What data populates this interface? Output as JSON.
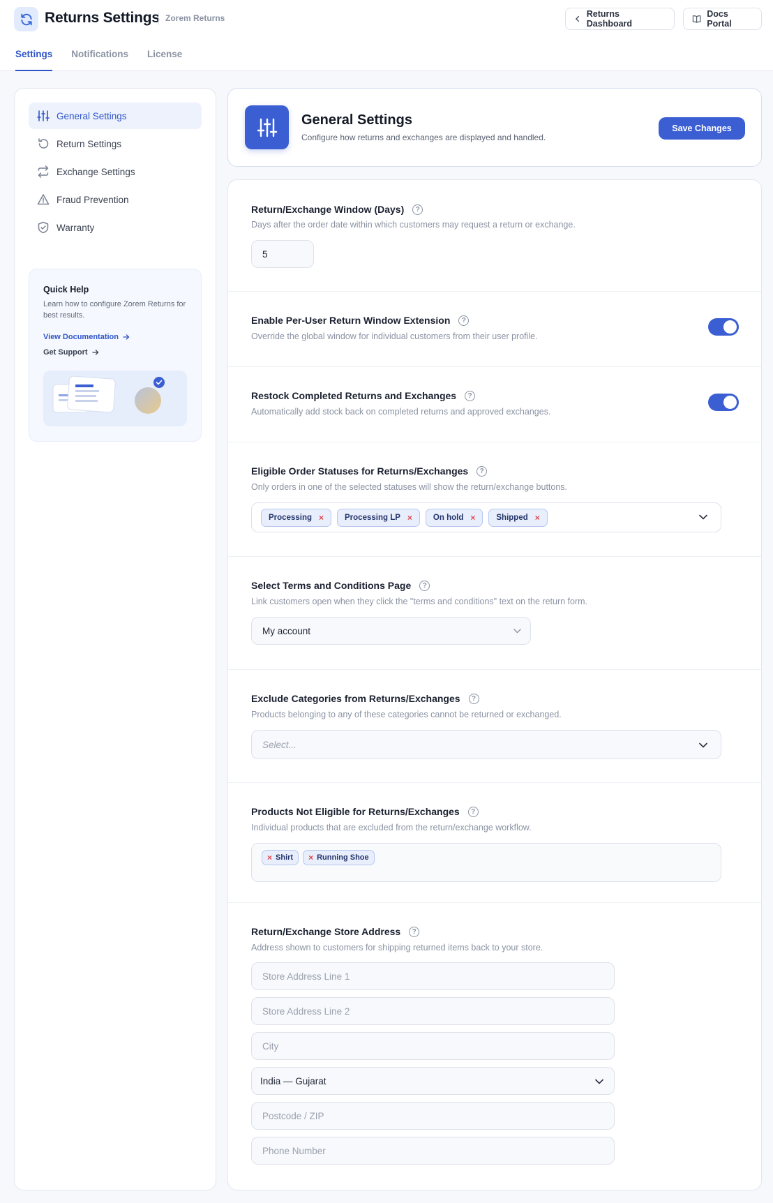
{
  "header": {
    "title": "Returns Settings",
    "subtitle": "Zorem Returns",
    "buttons": {
      "dashboard": "Returns Dashboard",
      "docs": "Docs Portal"
    },
    "tabs": [
      "Settings",
      "Notifications",
      "License"
    ]
  },
  "sidebar": {
    "items": [
      {
        "label": "General Settings",
        "icon": "sliders-icon"
      },
      {
        "label": "Return Settings",
        "icon": "return-icon"
      },
      {
        "label": "Exchange Settings",
        "icon": "exchange-icon"
      },
      {
        "label": "Fraud Prevention",
        "icon": "warning-icon"
      },
      {
        "label": "Warranty",
        "icon": "shield-icon"
      }
    ],
    "help": {
      "title": "Quick Help",
      "text": "Learn how to configure Zorem Returns for best results.",
      "docs_link": "View Documentation",
      "support_link": "Get Support"
    }
  },
  "main": {
    "title": "General Settings",
    "description": "Configure how returns and exchanges are displayed and handled.",
    "save_label": "Save Changes"
  },
  "settings": {
    "window": {
      "title": "Return/Exchange Window (Days)",
      "desc": "Days after the order date within which customers may request a return or exchange.",
      "value": "5"
    },
    "extension": {
      "title": "Enable Per-User Return Window Extension",
      "desc": "Override the global window for individual customers from their user profile.",
      "enabled": true
    },
    "restock": {
      "title": "Restock Completed Returns and Exchanges",
      "desc": "Automatically add stock back on completed returns and approved exchanges.",
      "enabled": true
    },
    "statuses": {
      "title": "Eligible Order Statuses for Returns/Exchanges",
      "desc": "Only orders in one of the selected statuses will show the return/exchange buttons.",
      "chips": [
        "Processing",
        "Processing LP",
        "On hold",
        "Shipped"
      ]
    },
    "terms": {
      "title": "Select Terms and Conditions Page",
      "desc": "Link customers open when they click the \"terms and conditions\" text on the return form.",
      "value": "My account"
    },
    "exclude": {
      "title": "Exclude Categories from Returns/Exchanges",
      "desc": "Products belonging to any of these categories cannot be returned or exchanged.",
      "placeholder": "Select..."
    },
    "products": {
      "title": "Products Not Eligible for Returns/Exchanges",
      "desc": "Individual products that are excluded from the return/exchange workflow.",
      "chips": [
        "Shirt",
        "Running Shoe"
      ]
    },
    "address": {
      "title": "Return/Exchange Store Address",
      "desc": "Address shown to customers for shipping returned items back to your store.",
      "line1_placeholder": "Store Address Line 1",
      "line2_placeholder": "Store Address Line 2",
      "city_placeholder": "City",
      "region": "India — Gujarat",
      "postcode_placeholder": "Postcode / ZIP",
      "phone_placeholder": "Phone Number"
    }
  },
  "colors": {
    "accent": "#3b5fd3",
    "remove": "#e0454b"
  }
}
